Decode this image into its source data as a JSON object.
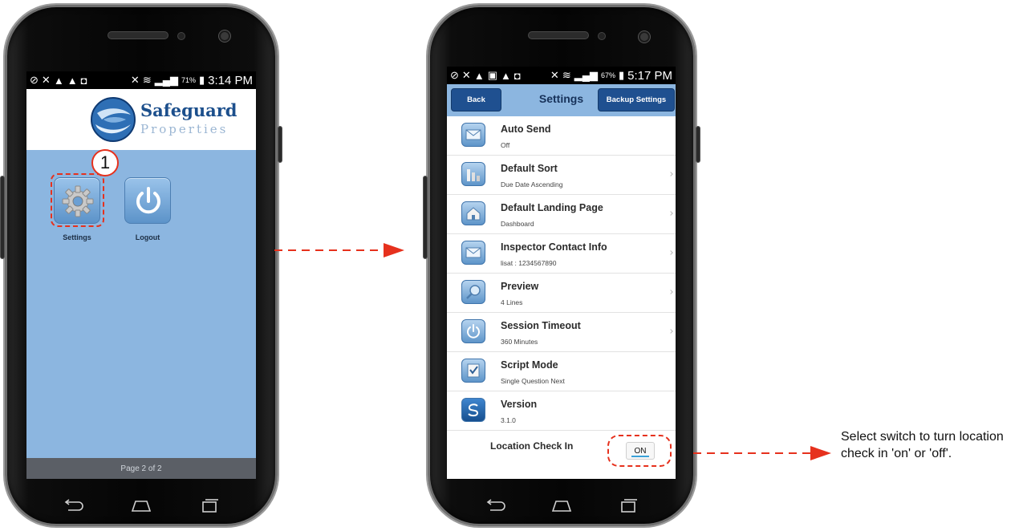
{
  "left_phone": {
    "status": {
      "time": "3:14 PM",
      "battery": "71%"
    },
    "brand": {
      "name": "Safeguard",
      "tagline": "Properties"
    },
    "step_number": "1",
    "tiles": [
      {
        "label": "Settings",
        "icon": "gear-icon"
      },
      {
        "label": "Logout",
        "icon": "power-icon"
      }
    ],
    "footer": "Page 2 of 2"
  },
  "right_phone": {
    "status": {
      "time": "5:17 PM",
      "battery": "67%"
    },
    "toolbar": {
      "back": "Back",
      "title": "Settings",
      "backup": "Backup Settings"
    },
    "settings": [
      {
        "title": "Auto Send",
        "value": "Off",
        "icon": "mail-send-icon"
      },
      {
        "title": "Default Sort",
        "value": "Due Date Ascending",
        "icon": "sort-bars-icon"
      },
      {
        "title": "Default Landing Page",
        "value": "Dashboard",
        "icon": "home-icon"
      },
      {
        "title": "Inspector Contact Info",
        "value": "lisat : 1234567890",
        "icon": "envelope-icon"
      },
      {
        "title": "Preview",
        "value": "4 Lines",
        "icon": "magnifier-icon"
      },
      {
        "title": "Session Timeout",
        "value": "360 Minutes",
        "icon": "power-icon"
      },
      {
        "title": "Script Mode",
        "value": "Single Question Next",
        "icon": "checklist-icon"
      },
      {
        "title": "Version",
        "value": "3.1.0",
        "icon": "safeguard-logo-icon"
      }
    ],
    "location": {
      "label": "Location Check In",
      "switch_value": "ON"
    }
  },
  "annotation": "Select switch to turn location check in 'on' or 'off'.",
  "colors": {
    "accent_red": "#e6311d",
    "app_blue": "#8cb6e0",
    "button_navy": "#1f5090"
  }
}
